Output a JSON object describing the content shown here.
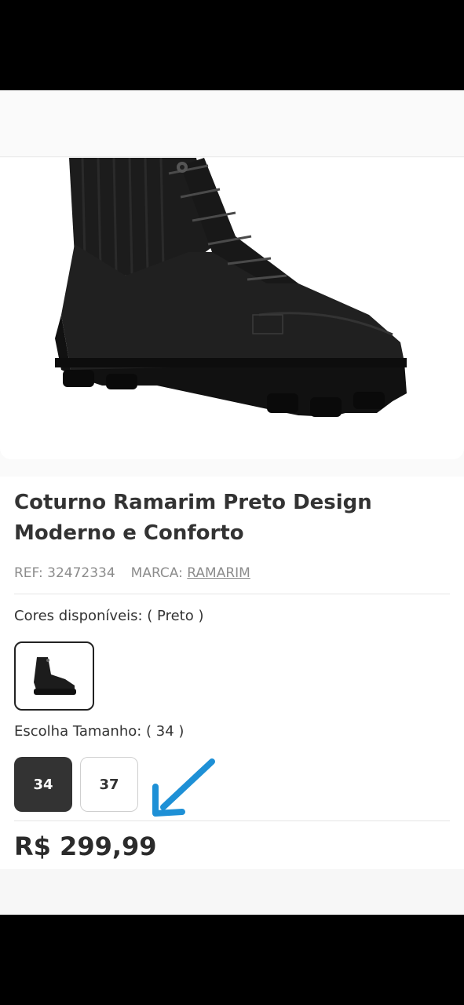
{
  "product": {
    "title": "Coturno Ramarim Preto Design Moderno e Conforto",
    "ref_label": "REF: 32472334",
    "brand_prefix": "MARCA:",
    "brand_name": "RAMARIM",
    "price": "R$ 299,99"
  },
  "colors": {
    "label": "Cores disponíveis: ( Preto )",
    "swatches": [
      {
        "name": "Preto",
        "selected": true
      }
    ]
  },
  "sizes": {
    "label": "Escolha Tamanho: ( 34 )",
    "options": [
      {
        "label": "34",
        "selected": true
      },
      {
        "label": "37",
        "selected": false
      }
    ]
  },
  "colors_palette": {
    "accent_arrow": "#1E90D6",
    "selected_size_bg": "#333333",
    "text_dark": "#333333",
    "text_muted": "#8c8c8c"
  },
  "icons": {
    "annotation": "arrow-down-left-icon"
  }
}
